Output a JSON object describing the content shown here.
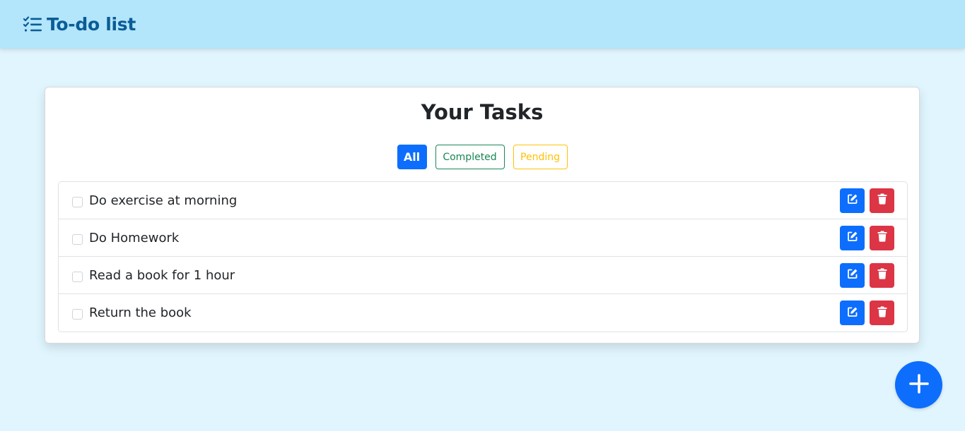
{
  "navbar": {
    "brand_icon": "list-check-icon",
    "brand_title": "To-do list"
  },
  "card": {
    "title": "Your Tasks",
    "filters": [
      {
        "label": "All",
        "active": true,
        "color": "#0d6efd"
      },
      {
        "label": "Completed",
        "active": false,
        "color": "#198754"
      },
      {
        "label": "Pending",
        "active": false,
        "color": "#ffc107"
      }
    ]
  },
  "tasks": [
    {
      "text": "Do exercise at morning",
      "checked": false
    },
    {
      "text": "Do Homework",
      "checked": false
    },
    {
      "text": "Read a book for 1 hour",
      "checked": false
    },
    {
      "text": "Return the book",
      "checked": false
    }
  ],
  "task_actions": {
    "edit_icon": "edit-icon",
    "delete_icon": "trash-icon"
  },
  "fab": {
    "icon": "plus-icon"
  },
  "colors": {
    "navbar_bg": "#b3e5fb",
    "page_bg": "#e0f5fe",
    "brand": "#0a5c96",
    "primary": "#0d6efd",
    "danger": "#dc3545",
    "success": "#198754",
    "warning": "#ffc107"
  }
}
